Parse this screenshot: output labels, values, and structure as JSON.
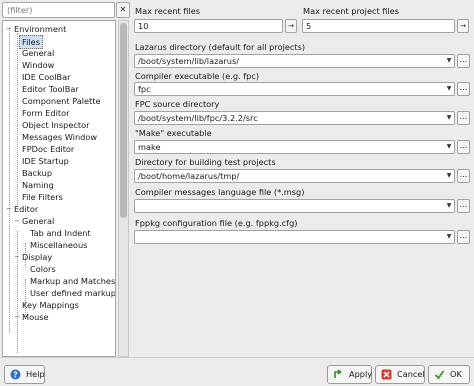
{
  "filter": {
    "placeholder": "(filter)",
    "clear_label": "✕"
  },
  "tree": {
    "items": [
      {
        "label": "Environment",
        "expander": "−"
      },
      {
        "label": "Files"
      },
      {
        "label": "General"
      },
      {
        "label": "Window"
      },
      {
        "label": "IDE CoolBar"
      },
      {
        "label": "Editor ToolBar"
      },
      {
        "label": "Component Palette"
      },
      {
        "label": "Form Editor"
      },
      {
        "label": "Object Inspector"
      },
      {
        "label": "Messages Window"
      },
      {
        "label": "FPDoc Editor"
      },
      {
        "label": "IDE Startup"
      },
      {
        "label": "Backup"
      },
      {
        "label": "Naming"
      },
      {
        "label": "File Filters"
      },
      {
        "label": "Editor",
        "expander": "−"
      },
      {
        "label": "General",
        "expander": "−"
      },
      {
        "label": "Tab and Indent"
      },
      {
        "label": "Miscellaneous"
      },
      {
        "label": "Display",
        "expander": "−"
      },
      {
        "label": "Colors"
      },
      {
        "label": "Markup and Matches"
      },
      {
        "label": "User defined markup"
      },
      {
        "label": "Key Mappings"
      },
      {
        "label": "Mouse",
        "expander": "−"
      }
    ],
    "selected": "Files"
  },
  "settings": {
    "max_recent_files": {
      "label": "Max recent files",
      "value": "10"
    },
    "max_recent_project_files": {
      "label": "Max recent project files",
      "value": "5"
    },
    "lazarus_dir": {
      "label": "Lazarus directory (default for all projects)",
      "value": "/boot/system/lib/lazarus/"
    },
    "compiler": {
      "label": "Compiler executable (e.g. fpc)",
      "value": "fpc"
    },
    "fpc_source": {
      "label": "FPC source directory",
      "value": "/boot/system/lib/fpc/3.2.2/src"
    },
    "make": {
      "label": "\"Make\" executable",
      "value": "make"
    },
    "test_dir": {
      "label": "Directory for building test projects",
      "value": "/boot/home/lazarus/tmp/"
    },
    "messages_file": {
      "label": "Compiler messages language file (*.msg)",
      "value": ""
    },
    "fppkg_config": {
      "label": "Fppkg configuration file (e.g. fppkg.cfg)",
      "value": ""
    },
    "dots_label": "...",
    "spin_label": "→"
  },
  "buttons": {
    "help": "Help",
    "apply": "Apply",
    "cancel": "Cancel",
    "ok": "OK"
  },
  "colors": {
    "help_icon": "#2a6fc4",
    "apply_icon": "#3a8a2e",
    "cancel_icon": "#d63b2f",
    "ok_icon": "#3a9a2e"
  }
}
